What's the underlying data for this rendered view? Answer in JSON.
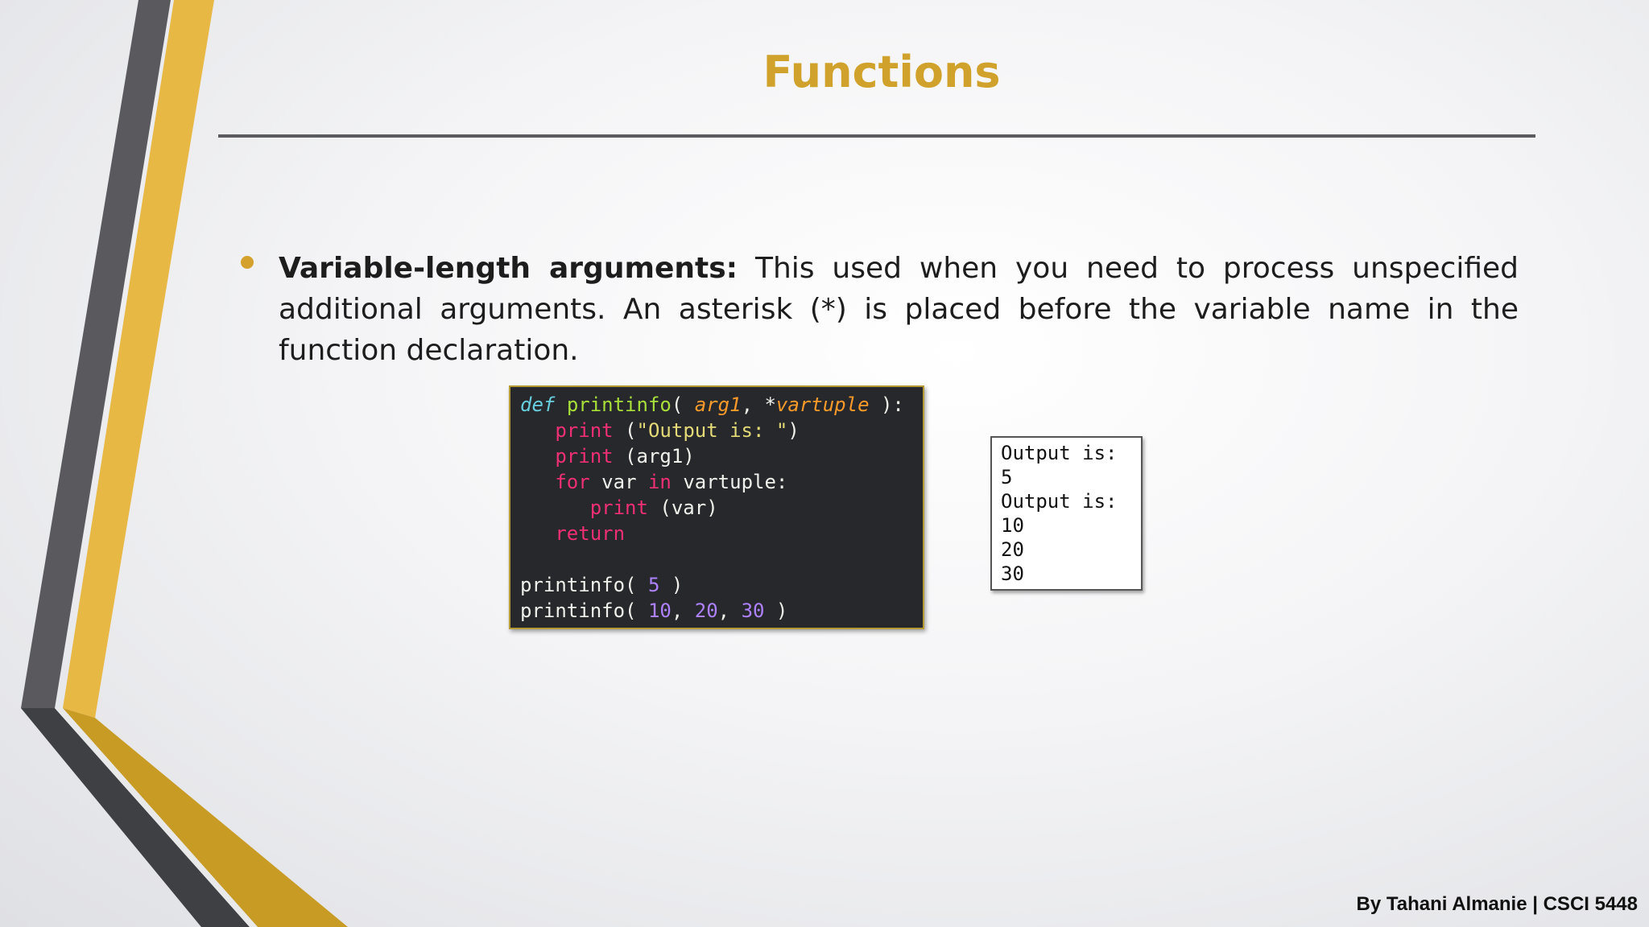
{
  "slide": {
    "title": "Functions",
    "bullet": {
      "term": "Variable-length arguments:",
      "text": " This used when you need to process unspecified additional arguments. An asterisk (*) is placed before the variable name in the function declaration."
    },
    "code_snippet": {
      "lines": [
        [
          [
            "kw-def",
            "def"
          ],
          [
            "pl",
            " "
          ],
          [
            "fn",
            "printinfo"
          ],
          [
            "pl",
            "( "
          ],
          [
            "param",
            "arg1"
          ],
          [
            "pl",
            ", *"
          ],
          [
            "param",
            "vartuple"
          ],
          [
            "pl",
            " ):"
          ]
        ],
        [
          [
            "pl",
            "   "
          ],
          [
            "kw",
            "print"
          ],
          [
            "pl",
            " ("
          ],
          [
            "str",
            "\"Output is: \""
          ],
          [
            "pl",
            ")"
          ]
        ],
        [
          [
            "pl",
            "   "
          ],
          [
            "kw",
            "print"
          ],
          [
            "pl",
            " (arg1)"
          ]
        ],
        [
          [
            "pl",
            "   "
          ],
          [
            "kw",
            "for"
          ],
          [
            "pl",
            " var "
          ],
          [
            "kw",
            "in"
          ],
          [
            "pl",
            " vartuple:"
          ]
        ],
        [
          [
            "pl",
            "      "
          ],
          [
            "kw",
            "print"
          ],
          [
            "pl",
            " (var)"
          ]
        ],
        [
          [
            "pl",
            "   "
          ],
          [
            "kw",
            "return"
          ]
        ],
        [
          [
            "pl",
            ""
          ]
        ],
        [
          [
            "pl",
            "printinfo( "
          ],
          [
            "num",
            "5"
          ],
          [
            "pl",
            " )"
          ]
        ],
        [
          [
            "pl",
            "printinfo( "
          ],
          [
            "num",
            "10"
          ],
          [
            "pl",
            ", "
          ],
          [
            "num",
            "20"
          ],
          [
            "pl",
            ", "
          ],
          [
            "num",
            "30"
          ],
          [
            "pl",
            " )"
          ]
        ]
      ]
    },
    "output": {
      "lines": [
        "Output is:",
        "5",
        "Output is:",
        "10",
        "20",
        "30"
      ]
    },
    "footer": "By Tahani Almanie | CSCI 5448"
  },
  "colors": {
    "accent": "#d1a22b",
    "rule": "#5b5b60",
    "code_bg": "#27282b"
  }
}
